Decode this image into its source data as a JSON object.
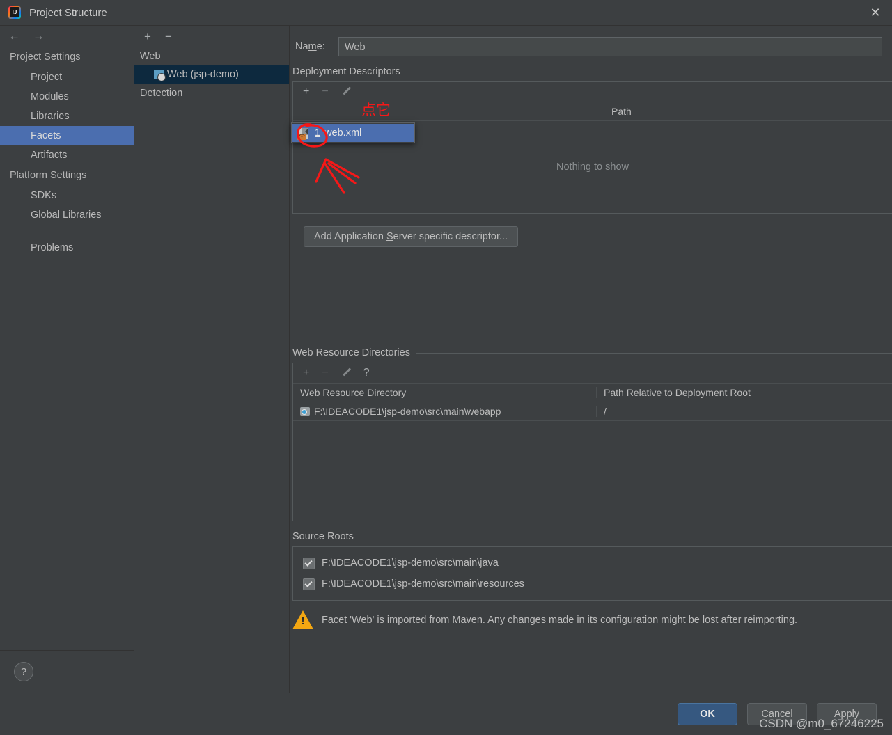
{
  "window": {
    "title": "Project Structure",
    "app_icon": "intellij-idea-icon",
    "close_icon": "close-icon"
  },
  "sidebar": {
    "back_icon": "arrow-left-icon",
    "forward_icon": "arrow-right-icon",
    "groups": [
      {
        "label": "Project Settings",
        "items": [
          {
            "label": "Project",
            "selected": false
          },
          {
            "label": "Modules",
            "selected": false
          },
          {
            "label": "Libraries",
            "selected": false
          },
          {
            "label": "Facets",
            "selected": true
          },
          {
            "label": "Artifacts",
            "selected": false
          }
        ]
      },
      {
        "label": "Platform Settings",
        "items": [
          {
            "label": "SDKs",
            "selected": false
          },
          {
            "label": "Global Libraries",
            "selected": false
          }
        ]
      }
    ],
    "problems_label": "Problems",
    "help_label": "?"
  },
  "facet_tree": {
    "toolbar": {
      "add": "+",
      "remove": "−"
    },
    "group_label": "Web",
    "selected_item": "Web (jsp-demo)",
    "detection_label": "Detection"
  },
  "facet_form": {
    "name_label_pre": "Na",
    "name_label_mnemonic": "m",
    "name_label_post": "e:",
    "name_value": "Web",
    "deployment_descriptors": {
      "section_title": "Deployment Descriptors",
      "toolbar": {
        "add": "+",
        "remove": "−",
        "edit": "edit-pencil-icon"
      },
      "columns": [
        "",
        "Path"
      ],
      "empty_text": "Nothing to show",
      "add_app_server_btn_pre": "Add Application ",
      "add_app_server_btn_mnemonic": "S",
      "add_app_server_btn_post": "erver specific descriptor..."
    },
    "web_resource_directories": {
      "section_title": "Web Resource Directories",
      "toolbar": {
        "add": "+",
        "remove": "−",
        "edit": "edit-pencil-icon",
        "help": "?"
      },
      "columns": [
        "Web Resource Directory",
        "Path Relative to Deployment Root"
      ],
      "rows": [
        {
          "directory": "F:\\IDEACODE1\\jsp-demo\\src\\main\\webapp",
          "path": "/"
        }
      ]
    },
    "source_roots": {
      "section_title": "Source Roots",
      "items": [
        {
          "label": "F:\\IDEACODE1\\jsp-demo\\src\\main\\java",
          "checked": true
        },
        {
          "label": "F:\\IDEACODE1\\jsp-demo\\src\\main\\resources",
          "checked": true
        }
      ]
    },
    "warning": {
      "icon": "warning-triangle-icon",
      "text": "Facet 'Web' is imported from Maven. Any changes made in its configuration might be lost after reimporting."
    }
  },
  "popup_menu": {
    "items": [
      {
        "index": "1",
        "label": "web.xml",
        "icon": "xml-file-icon",
        "selected": true
      }
    ]
  },
  "footer": {
    "ok_label": "OK",
    "cancel_label": "Cancel",
    "apply_label": "Apply"
  },
  "annotations": {
    "note_text": "点它",
    "color": "#f51818"
  },
  "watermark": {
    "text": "CSDN @m0_67246225"
  }
}
